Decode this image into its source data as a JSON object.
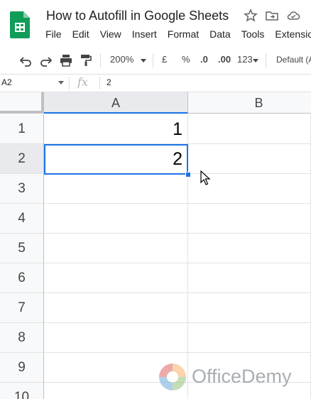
{
  "doc": {
    "title": "How to Autofill in Google Sheets",
    "menu": [
      "File",
      "Edit",
      "View",
      "Insert",
      "Format",
      "Data",
      "Tools",
      "Extensio"
    ]
  },
  "toolbar": {
    "zoom": "200%",
    "currency": "£",
    "percent": "%",
    "decrease_decimals": ".0",
    "increase_decimals": ".00",
    "number_format": "123",
    "font": "Default (A"
  },
  "formula_bar": {
    "name_box": "A2",
    "fx": "fx",
    "value": "2"
  },
  "grid": {
    "columns": [
      "A",
      "B"
    ],
    "rows": [
      "1",
      "2",
      "3",
      "4",
      "5",
      "6",
      "7",
      "8",
      "9",
      "10"
    ],
    "cells": {
      "A1": "1",
      "A2": "2"
    },
    "selected_cell": "A2"
  },
  "watermark": {
    "text": "OfficeDemy"
  },
  "colors": {
    "accent": "#1a73e8",
    "sheets_green": "#0f9d58"
  }
}
